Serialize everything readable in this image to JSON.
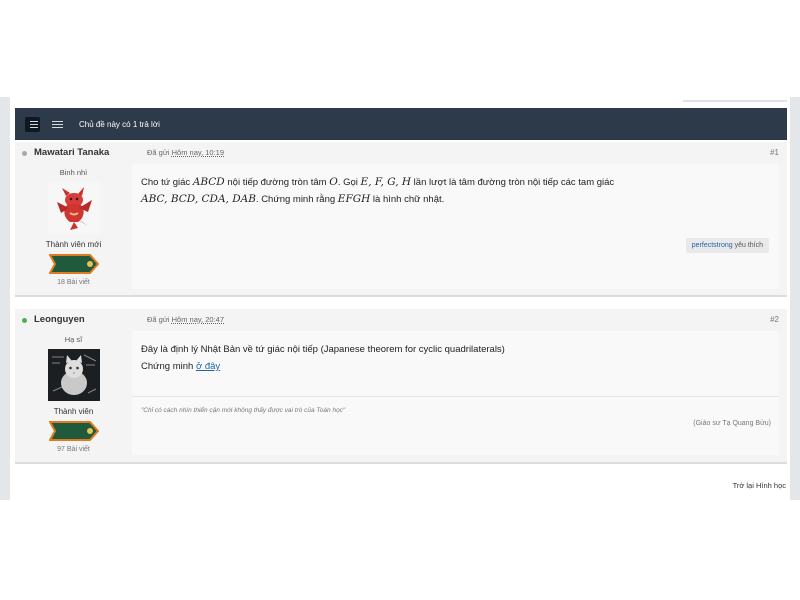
{
  "header": {
    "view_toggle_icons": [
      "threaded-view-icon",
      "linear-view-icon"
    ],
    "reply_count_text": "Chủ đề này có 1 trả lời"
  },
  "posts": [
    {
      "author": "Mawatari Tanaka",
      "online": false,
      "meta_label": "Đã gửi",
      "time": "Hôm nay, 10:19",
      "number": "#1",
      "rank": "Binh nhì",
      "member_title": "Thành viên mới",
      "post_count": "18 Bài viết",
      "body": {
        "line1_prefix": "Cho tứ giác ",
        "m1": "ABCD",
        "line1_mid": " nội tiếp đường tròn tâm ",
        "m2": "O",
        "line1_mid2": ". Gọi ",
        "m3": "E, F, G, H",
        "line1_suffix": " lần lượt là tâm đường tròn nội tiếp các tam giác",
        "m4": "ABC, BCD, CDA, DAB",
        "line2_mid": ". Chứng minh rằng ",
        "m5": "EFGH",
        "line2_suffix": " là hình chữ nhật."
      },
      "like": {
        "user": "perfectstrong",
        "text": " yêu thích"
      }
    },
    {
      "author": "Leonguyen",
      "online": true,
      "meta_label": "Đã gửi",
      "time": "Hôm nay, 20:47",
      "number": "#2",
      "rank": "Hạ sĩ",
      "member_title": "Thành viên",
      "post_count": "97 Bài viết",
      "body": {
        "line1": "Đây là định lý Nhật Bản về tứ giác nội tiếp (Japanese theorem for cyclic quadrilaterals)",
        "line2_prefix": "Chứng minh ",
        "link": "ở đây "
      },
      "signature": {
        "quote": "\"Chỉ có cách nhìn thiển cận mới không thấy được vai trò của Toán học\"",
        "author": "(Giáo sư Tạ Quang Bửu)"
      }
    }
  ],
  "colors": {
    "header_bg": "#2c3a4a",
    "online_dot": "#4caf50",
    "offline_dot": "#aaaaaa",
    "link": "#2164a8",
    "ribbon_green": "#1f5a3c",
    "ribbon_orange": "#e07a1f"
  },
  "footer": {
    "back_link": "Trở lại Hình học"
  }
}
